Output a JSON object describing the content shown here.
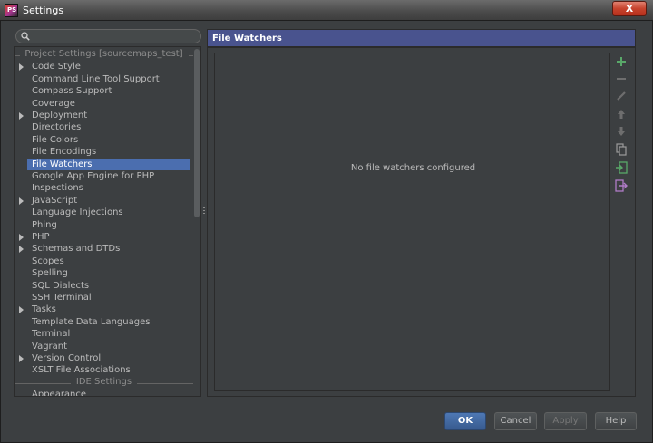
{
  "window": {
    "title": "Settings",
    "close_label": "X",
    "app_icon_text": "PS"
  },
  "search": {
    "value": ""
  },
  "tree": {
    "sections": [
      {
        "label": "Project Settings [sourcemaps_test]"
      },
      {
        "label": "IDE Settings"
      }
    ],
    "items": [
      {
        "label": "Code Style",
        "expandable": true
      },
      {
        "label": "Command Line Tool Support",
        "expandable": false
      },
      {
        "label": "Compass Support",
        "expandable": false
      },
      {
        "label": "Coverage",
        "expandable": false
      },
      {
        "label": "Deployment",
        "expandable": true
      },
      {
        "label": "Directories",
        "expandable": false
      },
      {
        "label": "File Colors",
        "expandable": false
      },
      {
        "label": "File Encodings",
        "expandable": false
      },
      {
        "label": "File Watchers",
        "expandable": false,
        "selected": true
      },
      {
        "label": "Google App Engine for PHP",
        "expandable": false
      },
      {
        "label": "Inspections",
        "expandable": false
      },
      {
        "label": "JavaScript",
        "expandable": true
      },
      {
        "label": "Language Injections",
        "expandable": false
      },
      {
        "label": "Phing",
        "expandable": false
      },
      {
        "label": "PHP",
        "expandable": true
      },
      {
        "label": "Schemas and DTDs",
        "expandable": true
      },
      {
        "label": "Scopes",
        "expandable": false
      },
      {
        "label": "Spelling",
        "expandable": false
      },
      {
        "label": "SQL Dialects",
        "expandable": false
      },
      {
        "label": "SSH Terminal",
        "expandable": false
      },
      {
        "label": "Tasks",
        "expandable": true
      },
      {
        "label": "Template Data Languages",
        "expandable": false
      },
      {
        "label": "Terminal",
        "expandable": false
      },
      {
        "label": "Vagrant",
        "expandable": false
      },
      {
        "label": "Version Control",
        "expandable": true
      },
      {
        "label": "XSLT File Associations",
        "expandable": false
      }
    ],
    "ide_items": [
      {
        "label": "Appearance",
        "expandable": false
      }
    ]
  },
  "panel": {
    "title": "File Watchers",
    "empty_text": "No file watchers configured",
    "toolbar": [
      {
        "icon": "add-icon",
        "color": "#59a869",
        "enabled": true
      },
      {
        "icon": "remove-icon",
        "color": "#6e6e6e",
        "enabled": false
      },
      {
        "icon": "edit-icon",
        "color": "#6e6e6e",
        "enabled": false
      },
      {
        "icon": "move-up-icon",
        "color": "#6e6e6e",
        "enabled": false
      },
      {
        "icon": "move-down-icon",
        "color": "#6e6e6e",
        "enabled": false
      },
      {
        "icon": "copy-icon",
        "color": "#9b9b9b",
        "enabled": false
      },
      {
        "icon": "import-icon",
        "color": "#59a869",
        "enabled": true
      },
      {
        "icon": "export-icon",
        "color": "#b07cc8",
        "enabled": true
      }
    ]
  },
  "buttons": {
    "ok": "OK",
    "cancel": "Cancel",
    "apply": "Apply",
    "help": "Help"
  },
  "colors": {
    "selection": "#4b6eaf",
    "header": "#49538e",
    "background": "#3c3f41"
  }
}
